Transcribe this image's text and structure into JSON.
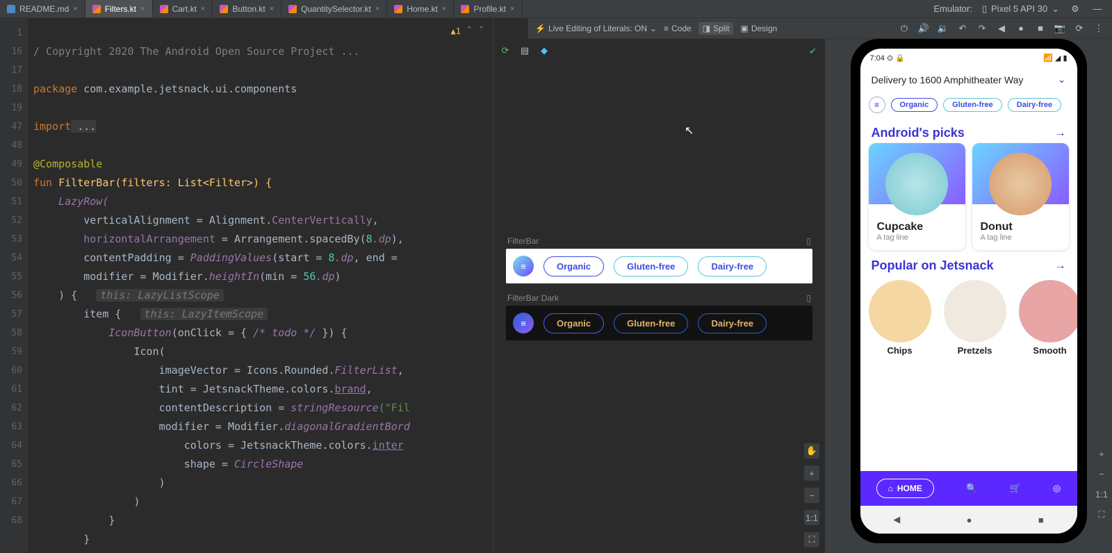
{
  "tabs": {
    "list": [
      {
        "label": "README.md",
        "type": "md"
      },
      {
        "label": "Filters.kt",
        "type": "kt",
        "active": true
      },
      {
        "label": "Cart.kt",
        "type": "kt"
      },
      {
        "label": "Button.kt",
        "type": "kt"
      },
      {
        "label": "QuantitySelector.kt",
        "type": "kt"
      },
      {
        "label": "Home.kt",
        "type": "kt"
      },
      {
        "label": "Profile.kt",
        "type": "kt"
      }
    ]
  },
  "tabbar_right": {
    "emulator_label": "Emulator:",
    "device_label": "Pixel 5 API 30"
  },
  "toolbar2": {
    "live_edit": "Live Editing of Literals: ON",
    "code": "Code",
    "split": "Split",
    "design": "Design"
  },
  "editor_badge": {
    "warn": "1"
  },
  "gutter_lines": [
    "1",
    "16",
    "17",
    "18",
    "19",
    "47",
    "48",
    "49",
    "50",
    "51",
    "52",
    "53",
    "54",
    "55",
    "56",
    "57",
    "58",
    "59",
    "60",
    "61",
    "62",
    "63",
    "64",
    "65",
    "66",
    "67",
    "68"
  ],
  "code": {
    "l1a": "/ Copyright 2020 The Android Open Source Project ...",
    "l3a": "package",
    "l3b": " com.example.jetsnack.ui.components",
    "l5a": "import",
    "l5b": " ...",
    "l7": "@Composable",
    "l8a": "fun",
    "l8b": " FilterBar(filters: List<Filter>) {",
    "l9": "    LazyRow(",
    "l10a": "        verticalAlignment = Alignment.",
    "l10b": "CenterVertically",
    "l10c": ",",
    "l11a": "        horizontalArrangement",
    "l11b": " = Arrangement.spacedBy(",
    "l11c": "8",
    "l11d": ".dp",
    "l11e": "),",
    "l12a": "        contentPadding = ",
    "l12b": "PaddingValues",
    "l12c": "(start = ",
    "l12d": "8",
    "l12e": ".dp",
    "l12f": ", end = ",
    "l13a": "        modifier = Modifier.",
    "l13b": "heightIn",
    "l13c": "(min = ",
    "l13d": "56",
    "l13e": ".dp",
    "l13f": ")",
    "l14a": "    ) {   ",
    "l14h": "this: LazyListScope",
    "l15a": "        item {   ",
    "l15h": "this: LazyItemScope",
    "l16a": "            IconButton",
    "l16b": "(onClick = { ",
    "l16c": "/* todo */",
    "l16d": " }) {",
    "l17": "                Icon(",
    "l18a": "                    imageVector = Icons.Rounded.",
    "l18b": "FilterList",
    "l18c": ",",
    "l19a": "                    tint = JetsnackTheme.colors.",
    "l19b": "brand",
    "l19c": ",",
    "l20a": "                    contentDescription = ",
    "l20b": "stringResource",
    "l20c": "(\"Fil",
    "l21a": "                    modifier = Modifier.",
    "l21b": "diagonalGradientBord",
    "l22a": "                        colors = JetsnackTheme.colors.",
    "l22b": "inter",
    "l23a": "                        shape = ",
    "l23b": "CircleShape",
    "l24": "                    )",
    "l25": "                )",
    "l26": "            }",
    "l27": "        }"
  },
  "design": {
    "panel1_title": "FilterBar",
    "panel2_title": "FilterBar Dark",
    "filters": [
      "Organic",
      "Gluten-free",
      "Dairy-free"
    ]
  },
  "zoom_label": "1:1",
  "emulator": {
    "clock": "7:04",
    "delivery": "Delivery to 1600 Amphitheater Way",
    "filters": [
      "Organic",
      "Gluten-free",
      "Dairy-free"
    ],
    "section1": "Android's picks",
    "card1_title": "Cupcake",
    "card_tag": "A tag line",
    "card2_title": "Donut",
    "section2": "Popular on Jetsnack",
    "snacks": [
      "Chips",
      "Pretzels",
      "Smooth"
    ],
    "home": "HOME"
  }
}
